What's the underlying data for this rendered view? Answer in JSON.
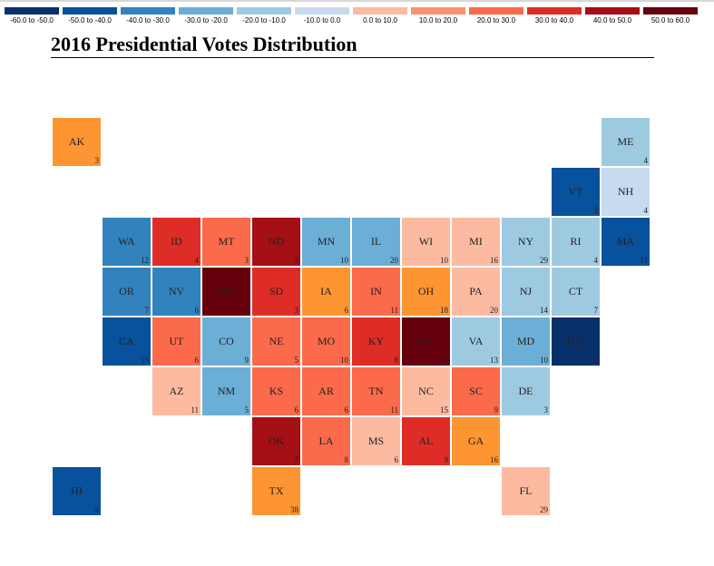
{
  "chart_data": {
    "type": "heatmap",
    "title": "2016 Presidential Votes Distribution",
    "legend": {
      "placement": "top",
      "bins": [
        {
          "label": "-60.0 to -50.0",
          "color": "#08306b"
        },
        {
          "label": "-50.0 to -40.0",
          "color": "#08519c"
        },
        {
          "label": "-40.0 to -30.0",
          "color": "#3182bd"
        },
        {
          "label": "-30.0 to -20.0",
          "color": "#6baed6"
        },
        {
          "label": "-20.0 to -10.0",
          "color": "#9ecae1"
        },
        {
          "label": "-10.0 to 0.0",
          "color": "#c6dbef"
        },
        {
          "label": "0.0 to 10.0",
          "color": "#fcbba1"
        },
        {
          "label": "10.0 to 20.0",
          "color": "#fc9272"
        },
        {
          "label": "20.0 to 30.0",
          "color": "#fb6a4a"
        },
        {
          "label": "30.0 to 40.0",
          "color": "#de2d26"
        },
        {
          "label": "40.0 to 50.0",
          "color": "#a50f15"
        },
        {
          "label": "50.0 to 60.0",
          "color": "#67000d"
        }
      ]
    },
    "tiles": [
      {
        "state": "AK",
        "ev": 3,
        "col": 0,
        "row": 0,
        "color": "#fd9532"
      },
      {
        "state": "ME",
        "ev": 4,
        "col": 11,
        "row": 0,
        "color": "#9ecae1"
      },
      {
        "state": "VT",
        "ev": 3,
        "col": 10,
        "row": 1,
        "color": "#08519c"
      },
      {
        "state": "NH",
        "ev": 4,
        "col": 11,
        "row": 1,
        "color": "#c6dbef"
      },
      {
        "state": "WA",
        "ev": 12,
        "col": 1,
        "row": 2,
        "color": "#3182bd"
      },
      {
        "state": "ID",
        "ev": 4,
        "col": 2,
        "row": 2,
        "color": "#de2d26"
      },
      {
        "state": "MT",
        "ev": 3,
        "col": 3,
        "row": 2,
        "color": "#fb6a4a"
      },
      {
        "state": "ND",
        "ev": 3,
        "col": 4,
        "row": 2,
        "color": "#a50f15"
      },
      {
        "state": "MN",
        "ev": 10,
        "col": 5,
        "row": 2,
        "color": "#6baed6"
      },
      {
        "state": "IL",
        "ev": 20,
        "col": 6,
        "row": 2,
        "color": "#6baed6"
      },
      {
        "state": "WI",
        "ev": 10,
        "col": 7,
        "row": 2,
        "color": "#fcbba1"
      },
      {
        "state": "MI",
        "ev": 16,
        "col": 8,
        "row": 2,
        "color": "#fcbba1"
      },
      {
        "state": "NY",
        "ev": 29,
        "col": 9,
        "row": 2,
        "color": "#9ecae1"
      },
      {
        "state": "RI",
        "ev": 4,
        "col": 10,
        "row": 2,
        "color": "#9ecae1"
      },
      {
        "state": "MA",
        "ev": 11,
        "col": 11,
        "row": 2,
        "color": "#08519c"
      },
      {
        "state": "OR",
        "ev": 7,
        "col": 1,
        "row": 3,
        "color": "#3182bd"
      },
      {
        "state": "NV",
        "ev": 6,
        "col": 2,
        "row": 3,
        "color": "#3182bd"
      },
      {
        "state": "WY",
        "ev": 3,
        "col": 3,
        "row": 3,
        "color": "#67000d"
      },
      {
        "state": "SD",
        "ev": 3,
        "col": 4,
        "row": 3,
        "color": "#de2d26"
      },
      {
        "state": "IA",
        "ev": 6,
        "col": 5,
        "row": 3,
        "color": "#fd9532"
      },
      {
        "state": "IN",
        "ev": 11,
        "col": 6,
        "row": 3,
        "color": "#fb6a4a"
      },
      {
        "state": "OH",
        "ev": 18,
        "col": 7,
        "row": 3,
        "color": "#fd9532"
      },
      {
        "state": "PA",
        "ev": 20,
        "col": 8,
        "row": 3,
        "color": "#fcbba1"
      },
      {
        "state": "NJ",
        "ev": 14,
        "col": 9,
        "row": 3,
        "color": "#9ecae1"
      },
      {
        "state": "CT",
        "ev": 7,
        "col": 10,
        "row": 3,
        "color": "#9ecae1"
      },
      {
        "state": "CA",
        "ev": 55,
        "col": 1,
        "row": 4,
        "color": "#08519c"
      },
      {
        "state": "UT",
        "ev": 6,
        "col": 2,
        "row": 4,
        "color": "#fb6a4a"
      },
      {
        "state": "CO",
        "ev": 9,
        "col": 3,
        "row": 4,
        "color": "#6baed6"
      },
      {
        "state": "NE",
        "ev": 5,
        "col": 4,
        "row": 4,
        "color": "#fb6a4a"
      },
      {
        "state": "MO",
        "ev": 10,
        "col": 5,
        "row": 4,
        "color": "#fb6a4a"
      },
      {
        "state": "KY",
        "ev": 8,
        "col": 6,
        "row": 4,
        "color": "#de2d26"
      },
      {
        "state": "WV",
        "ev": 5,
        "col": 7,
        "row": 4,
        "color": "#67000d"
      },
      {
        "state": "VA",
        "ev": 13,
        "col": 8,
        "row": 4,
        "color": "#9ecae1"
      },
      {
        "state": "MD",
        "ev": 10,
        "col": 9,
        "row": 4,
        "color": "#6baed6"
      },
      {
        "state": "D.C",
        "ev": 3,
        "col": 10,
        "row": 4,
        "color": "#08306b"
      },
      {
        "state": "AZ",
        "ev": 11,
        "col": 2,
        "row": 5,
        "color": "#fcbba1"
      },
      {
        "state": "NM",
        "ev": 5,
        "col": 3,
        "row": 5,
        "color": "#6baed6"
      },
      {
        "state": "KS",
        "ev": 6,
        "col": 4,
        "row": 5,
        "color": "#fb6a4a"
      },
      {
        "state": "AR",
        "ev": 6,
        "col": 5,
        "row": 5,
        "color": "#fb6a4a"
      },
      {
        "state": "TN",
        "ev": 11,
        "col": 6,
        "row": 5,
        "color": "#fb6a4a"
      },
      {
        "state": "NC",
        "ev": 15,
        "col": 7,
        "row": 5,
        "color": "#fcbba1"
      },
      {
        "state": "SC",
        "ev": 9,
        "col": 8,
        "row": 5,
        "color": "#fb6a4a"
      },
      {
        "state": "DE",
        "ev": 3,
        "col": 9,
        "row": 5,
        "color": "#9ecae1"
      },
      {
        "state": "OK",
        "ev": 7,
        "col": 4,
        "row": 6,
        "color": "#a50f15"
      },
      {
        "state": "LA",
        "ev": 8,
        "col": 5,
        "row": 6,
        "color": "#fb6a4a"
      },
      {
        "state": "MS",
        "ev": 6,
        "col": 6,
        "row": 6,
        "color": "#fcbba1"
      },
      {
        "state": "AL",
        "ev": 9,
        "col": 7,
        "row": 6,
        "color": "#de2d26"
      },
      {
        "state": "GA",
        "ev": 16,
        "col": 8,
        "row": 6,
        "color": "#fd9532"
      },
      {
        "state": "HI",
        "ev": 4,
        "col": 0,
        "row": 7,
        "color": "#08519c"
      },
      {
        "state": "TX",
        "ev": 38,
        "col": 4,
        "row": 7,
        "color": "#fd9532"
      },
      {
        "state": "FL",
        "ev": 29,
        "col": 9,
        "row": 7,
        "color": "#fcbba1"
      }
    ]
  }
}
